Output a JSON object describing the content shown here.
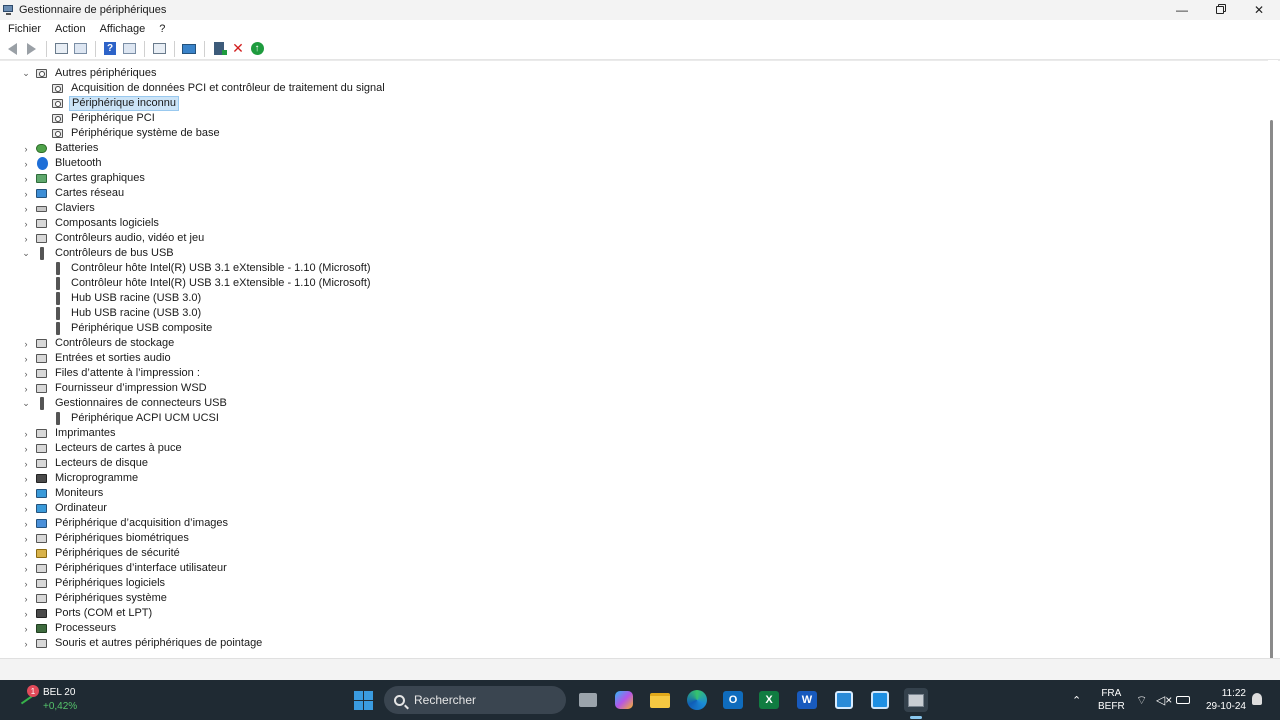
{
  "window": {
    "title": "Gestionnaire de périphériques",
    "minimize": "—",
    "close": "✕"
  },
  "menu": [
    "Fichier",
    "Action",
    "Affichage",
    "?"
  ],
  "toolbar": {
    "buttons": [
      "back-icon",
      "forward-icon",
      "show-hide-console-tree-icon",
      "properties-icon",
      "help-icon",
      "view-icon",
      "scan-hardware-icon",
      "monitor-icon",
      "update-driver-icon",
      "uninstall-icon",
      "enable-icon"
    ]
  },
  "tree": {
    "rows": [
      {
        "label": "Autres périphériques",
        "level": 0,
        "expanded": true,
        "icon": "unknown-device-icon"
      },
      {
        "label": "Acquisition de données PCI et contrôleur de traitement du signal",
        "level": 1,
        "icon": "unknown-device-icon"
      },
      {
        "label": "Périphérique inconnu",
        "level": 1,
        "icon": "unknown-device-icon",
        "selected": true
      },
      {
        "label": "Périphérique PCI",
        "level": 1,
        "icon": "unknown-device-icon"
      },
      {
        "label": "Périphérique système de base",
        "level": 1,
        "icon": "unknown-device-icon"
      },
      {
        "label": "Batteries",
        "level": 0,
        "expanded": false,
        "icon": "battery-icon"
      },
      {
        "label": "Bluetooth",
        "level": 0,
        "expanded": false,
        "icon": "bluetooth-icon"
      },
      {
        "label": "Cartes graphiques",
        "level": 0,
        "expanded": false,
        "icon": "display-adapter-icon"
      },
      {
        "label": "Cartes réseau",
        "level": 0,
        "expanded": false,
        "icon": "network-adapter-icon"
      },
      {
        "label": "Claviers",
        "level": 0,
        "expanded": false,
        "icon": "keyboard-icon"
      },
      {
        "label": "Composants logiciels",
        "level": 0,
        "expanded": false,
        "icon": "software-component-icon"
      },
      {
        "label": "Contrôleurs audio, vidéo et jeu",
        "level": 0,
        "expanded": false,
        "icon": "audio-icon"
      },
      {
        "label": "Contrôleurs de bus USB",
        "level": 0,
        "expanded": true,
        "icon": "usb-icon"
      },
      {
        "label": "Contrôleur hôte Intel(R) USB 3.1 eXtensible - 1.10 (Microsoft)",
        "level": 1,
        "icon": "usb-icon"
      },
      {
        "label": "Contrôleur hôte Intel(R) USB 3.1 eXtensible - 1.10 (Microsoft)",
        "level": 1,
        "icon": "usb-icon"
      },
      {
        "label": "Hub USB racine (USB 3.0)",
        "level": 1,
        "icon": "usb-icon"
      },
      {
        "label": "Hub USB racine (USB 3.0)",
        "level": 1,
        "icon": "usb-icon"
      },
      {
        "label": "Périphérique USB composite",
        "level": 1,
        "icon": "usb-icon"
      },
      {
        "label": "Contrôleurs de stockage",
        "level": 0,
        "expanded": false,
        "icon": "storage-controller-icon"
      },
      {
        "label": "Entrées et sorties audio",
        "level": 0,
        "expanded": false,
        "icon": "audio-io-icon"
      },
      {
        "label": "Files d’attente à l’impression :",
        "level": 0,
        "expanded": false,
        "icon": "print-queue-icon"
      },
      {
        "label": "Fournisseur d’impression WSD",
        "level": 0,
        "expanded": false,
        "icon": "printer-icon"
      },
      {
        "label": "Gestionnaires de connecteurs USB",
        "level": 0,
        "expanded": true,
        "icon": "usb-icon"
      },
      {
        "label": "Périphérique ACPI UCM UCSI",
        "level": 1,
        "icon": "usb-icon"
      },
      {
        "label": "Imprimantes",
        "level": 0,
        "expanded": false,
        "icon": "printer-icon"
      },
      {
        "label": "Lecteurs de cartes à puce",
        "level": 0,
        "expanded": false,
        "icon": "smartcard-reader-icon"
      },
      {
        "label": "Lecteurs de disque",
        "level": 0,
        "expanded": false,
        "icon": "disk-drive-icon"
      },
      {
        "label": "Microprogramme",
        "level": 0,
        "expanded": false,
        "icon": "firmware-icon"
      },
      {
        "label": "Moniteurs",
        "level": 0,
        "expanded": false,
        "icon": "monitor-icon"
      },
      {
        "label": "Ordinateur",
        "level": 0,
        "expanded": false,
        "icon": "computer-icon"
      },
      {
        "label": "Périphérique d’acquisition d’images",
        "level": 0,
        "expanded": false,
        "icon": "imaging-device-icon"
      },
      {
        "label": "Périphériques biométriques",
        "level": 0,
        "expanded": false,
        "icon": "biometric-icon"
      },
      {
        "label": "Périphériques de sécurité",
        "level": 0,
        "expanded": false,
        "icon": "security-device-icon"
      },
      {
        "label": "Périphériques d’interface utilisateur",
        "level": 0,
        "expanded": false,
        "icon": "hid-icon"
      },
      {
        "label": "Périphériques logiciels",
        "level": 0,
        "expanded": false,
        "icon": "software-device-icon"
      },
      {
        "label": "Périphériques système",
        "level": 0,
        "expanded": false,
        "icon": "system-device-icon"
      },
      {
        "label": "Ports (COM et LPT)",
        "level": 0,
        "expanded": false,
        "icon": "port-icon"
      },
      {
        "label": "Processeurs",
        "level": 0,
        "expanded": false,
        "icon": "processor-icon"
      },
      {
        "label": "Souris et autres périphériques de pointage",
        "level": 0,
        "expanded": false,
        "icon": "mouse-icon"
      }
    ]
  },
  "taskbar": {
    "weather": {
      "badge": "1",
      "name": "BEL 20",
      "change": "+0,42%"
    },
    "search_placeholder": "Rechercher",
    "apps": [
      "file-explorer-icon",
      "copilot-icon",
      "folder-icon",
      "edge-icon",
      "outlook-icon",
      "excel-icon",
      "word-icon",
      "calculator-icon",
      "store-icon",
      "device-manager-icon"
    ],
    "language": {
      "line1": "FRA",
      "line2": "BEFR"
    },
    "clock": {
      "time": "11:22",
      "date": "29-10-24"
    }
  }
}
